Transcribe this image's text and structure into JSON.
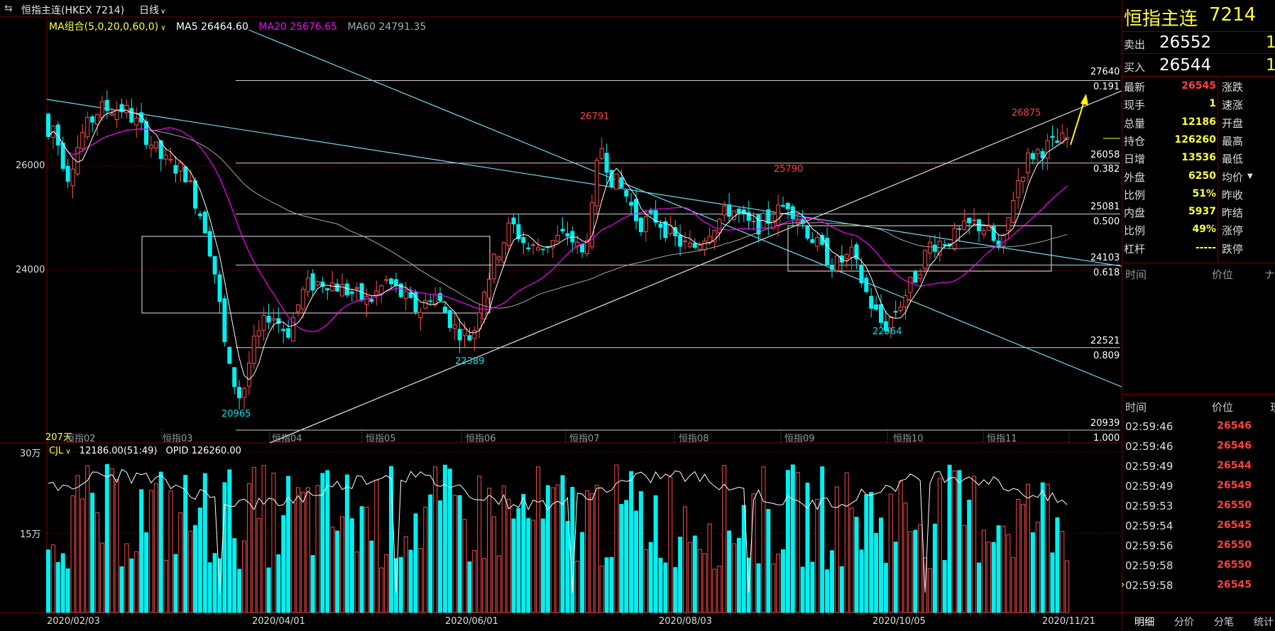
{
  "header": {
    "icon": "swap-arrows-icon",
    "instrument": "恒指主连(HKEX 7214)",
    "period": "日线"
  },
  "ma_legend": {
    "group": "MA组合(5,0,20,0,60,0)",
    "ma5": "MA5 26464.60",
    "ma20": "MA20 25676.65",
    "ma60": "MA60 24791.35",
    "colors": {
      "ma5": "#ffffff",
      "ma20": "#ff00ff",
      "ma60": "#a8a8a8"
    }
  },
  "price_axis": {
    "labels": [
      "26000",
      "24000"
    ],
    "scale": {
      "p1": 26000,
      "p2": 24000
    }
  },
  "fib": {
    "levels": [
      {
        "price": "27640",
        "ratio": "0.191"
      },
      {
        "price": "26058",
        "ratio": "0.382"
      },
      {
        "price": "25081",
        "ratio": "0.500"
      },
      {
        "price": "24103",
        "ratio": "0.618"
      },
      {
        "price": "22521",
        "ratio": "0.809"
      },
      {
        "price": "20939",
        "ratio": "1.000"
      }
    ]
  },
  "annotations": {
    "peak1": "26791",
    "peak2": "25790",
    "peak3": "26875",
    "low1": "22389",
    "low2": "22964",
    "low3": "20965",
    "days": "207天"
  },
  "month_labels": [
    "恒指02",
    "恒指03",
    "恒指04",
    "恒指05",
    "恒指06",
    "恒指07",
    "恒指08",
    "恒指09",
    "恒指10",
    "恒指11"
  ],
  "volume": {
    "axis": [
      "30万",
      "15万"
    ],
    "legend_name": "CJL",
    "legend_vol": "12186.00(51:49)",
    "legend_opid": "OPID 126260.00"
  },
  "date_axis": [
    "2020/02/03",
    "2020/04/01",
    "2020/06/01",
    "2020/08/03",
    "2020/10/05",
    "2020/11/21"
  ],
  "quote": {
    "title": "恒指主连",
    "code": "7214",
    "sell_label": "卖出",
    "sell_price": "26552",
    "sell_vol": "1",
    "buy_label": "买入",
    "buy_price": "26544",
    "buy_vol": "1",
    "rows": [
      {
        "label": "最新",
        "value": "26545",
        "color": "red",
        "label2": "涨跌"
      },
      {
        "label": "现手",
        "value": "1",
        "color": "yellow",
        "label2": "速涨"
      },
      {
        "label": "总量",
        "value": "12186",
        "color": "yellow",
        "label2": "开盘"
      },
      {
        "label": "持仓",
        "value": "126260",
        "color": "yellow",
        "label2": "最高"
      },
      {
        "label": "日增",
        "value": "13536",
        "color": "yellow",
        "label2": "最低"
      },
      {
        "label": "外盘",
        "value": "6250",
        "color": "yellow",
        "label2": "均价"
      },
      {
        "label": "比例",
        "value": "51%",
        "color": "yellow",
        "label2": "昨收"
      },
      {
        "label": "内盘",
        "value": "5937",
        "color": "yellow",
        "label2": "昨结"
      },
      {
        "label": "比例",
        "value": "49%",
        "color": "yellow",
        "label2": "涨停"
      },
      {
        "label": "杠杆",
        "value": "-----",
        "color": "yellow",
        "label2": "跌停"
      }
    ],
    "mid_header": {
      "time": "时间",
      "price": "价位",
      "vol": "ナ"
    }
  },
  "ticks": {
    "header": {
      "time": "时间",
      "price": "价位",
      "vol": "现"
    },
    "rows": [
      {
        "time": "02:59:46",
        "price": "26546"
      },
      {
        "time": "02:59:46",
        "price": "26546"
      },
      {
        "time": "02:59:49",
        "price": "26544"
      },
      {
        "time": "02:59:49",
        "price": "26549"
      },
      {
        "time": "02:59:53",
        "price": "26550"
      },
      {
        "time": "02:59:54",
        "price": "26545"
      },
      {
        "time": "02:59:56",
        "price": "26550"
      },
      {
        "time": "02:59:58",
        "price": "26550"
      },
      {
        "time": "02:59:58",
        "price": "26545"
      }
    ]
  },
  "bottom_tabs": [
    "明细",
    "分价",
    "分笔",
    "统计"
  ]
}
